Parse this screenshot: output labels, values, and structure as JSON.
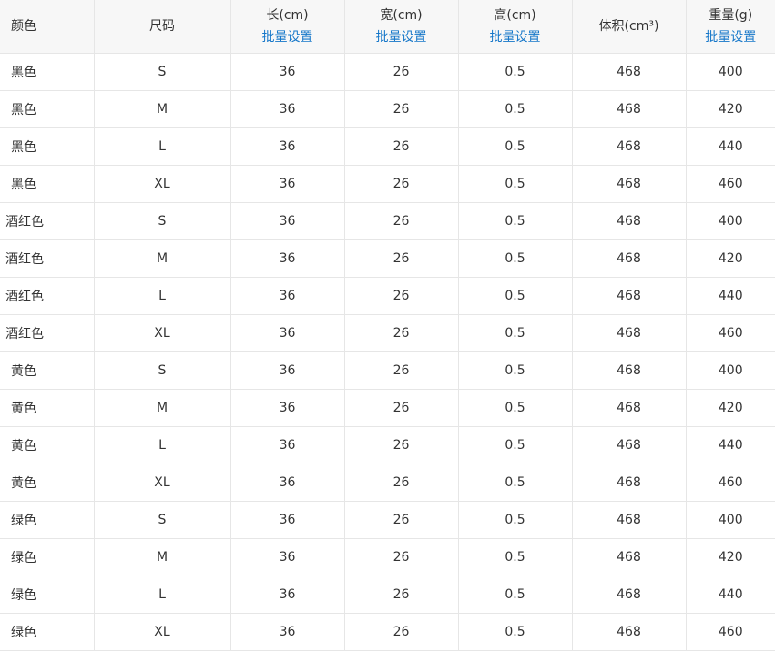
{
  "table": {
    "headers": {
      "color": "颜色",
      "size": "尺码",
      "length": "长(cm)",
      "width": "宽(cm)",
      "height": "高(cm)",
      "volume": "体积(cm³)",
      "weight": "重量(g)"
    },
    "batch_label": "批量设置",
    "rows": [
      {
        "color": "黑色",
        "size": "S",
        "length": "36",
        "width": "26",
        "height": "0.5",
        "volume": "468",
        "weight": "400"
      },
      {
        "color": "黑色",
        "size": "M",
        "length": "36",
        "width": "26",
        "height": "0.5",
        "volume": "468",
        "weight": "420"
      },
      {
        "color": "黑色",
        "size": "L",
        "length": "36",
        "width": "26",
        "height": "0.5",
        "volume": "468",
        "weight": "440"
      },
      {
        "color": "黑色",
        "size": "XL",
        "length": "36",
        "width": "26",
        "height": "0.5",
        "volume": "468",
        "weight": "460"
      },
      {
        "color": "酒红色",
        "size": "S",
        "length": "36",
        "width": "26",
        "height": "0.5",
        "volume": "468",
        "weight": "400"
      },
      {
        "color": "酒红色",
        "size": "M",
        "length": "36",
        "width": "26",
        "height": "0.5",
        "volume": "468",
        "weight": "420"
      },
      {
        "color": "酒红色",
        "size": "L",
        "length": "36",
        "width": "26",
        "height": "0.5",
        "volume": "468",
        "weight": "440"
      },
      {
        "color": "酒红色",
        "size": "XL",
        "length": "36",
        "width": "26",
        "height": "0.5",
        "volume": "468",
        "weight": "460"
      },
      {
        "color": "黄色",
        "size": "S",
        "length": "36",
        "width": "26",
        "height": "0.5",
        "volume": "468",
        "weight": "400"
      },
      {
        "color": "黄色",
        "size": "M",
        "length": "36",
        "width": "26",
        "height": "0.5",
        "volume": "468",
        "weight": "420"
      },
      {
        "color": "黄色",
        "size": "L",
        "length": "36",
        "width": "26",
        "height": "0.5",
        "volume": "468",
        "weight": "440"
      },
      {
        "color": "黄色",
        "size": "XL",
        "length": "36",
        "width": "26",
        "height": "0.5",
        "volume": "468",
        "weight": "460"
      },
      {
        "color": "绿色",
        "size": "S",
        "length": "36",
        "width": "26",
        "height": "0.5",
        "volume": "468",
        "weight": "400"
      },
      {
        "color": "绿色",
        "size": "M",
        "length": "36",
        "width": "26",
        "height": "0.5",
        "volume": "468",
        "weight": "420"
      },
      {
        "color": "绿色",
        "size": "L",
        "length": "36",
        "width": "26",
        "height": "0.5",
        "volume": "468",
        "weight": "440"
      },
      {
        "color": "绿色",
        "size": "XL",
        "length": "36",
        "width": "26",
        "height": "0.5",
        "volume": "468",
        "weight": "460"
      }
    ]
  },
  "colors": {
    "link": "#1677c9",
    "header_bg": "#f7f7f7",
    "border": "#e6e6e6",
    "text": "#333333"
  }
}
